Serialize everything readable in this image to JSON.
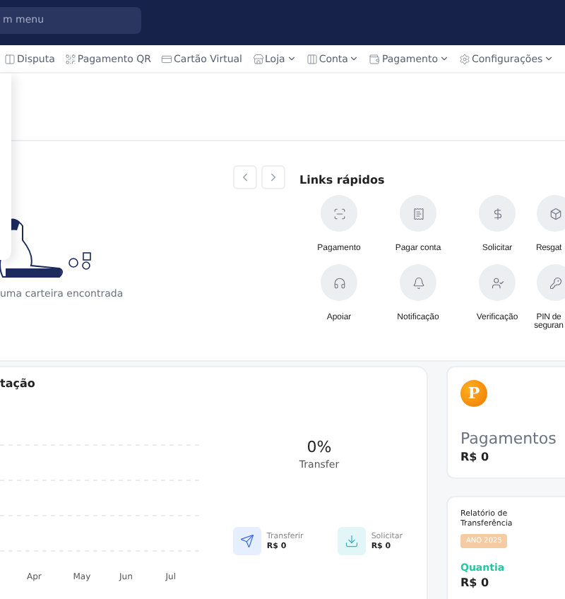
{
  "search": {
    "placeholder": "m menu"
  },
  "nav": [
    {
      "label": "Disputa",
      "kind": "dispute",
      "dropdown": false
    },
    {
      "label": "Pagamento QR",
      "kind": "qr",
      "dropdown": false
    },
    {
      "label": "Cartão Virtual",
      "kind": "card",
      "dropdown": false
    },
    {
      "label": "Loja",
      "kind": "store",
      "dropdown": true
    },
    {
      "label": "Conta",
      "kind": "account",
      "dropdown": true
    },
    {
      "label": "Pagamento",
      "kind": "wallet",
      "dropdown": true
    },
    {
      "label": "Configurações",
      "kind": "settings",
      "dropdown": true
    }
  ],
  "wallet": {
    "empty_text": "uma carteira encontrada"
  },
  "quick_links": {
    "title": "Links rápidos",
    "items": [
      {
        "label": "Pagamento",
        "kind": "payment"
      },
      {
        "label": "Pagar conta",
        "kind": "bill"
      },
      {
        "label": "Solicitar",
        "kind": "dollar"
      },
      {
        "label": "Resgat",
        "kind": "box"
      },
      {
        "label": "Apoiar",
        "kind": "headset"
      },
      {
        "label": "Notificação",
        "kind": "bell"
      },
      {
        "label": "Verificação",
        "kind": "user"
      },
      {
        "label": "PIN de seguran",
        "kind": "key"
      }
    ]
  },
  "chart_card": {
    "title": "tação",
    "x_labels": [
      "Apr",
      "May",
      "Jun",
      "Jul"
    ],
    "percent": "0%",
    "percent_label": "Transfer",
    "stats": [
      {
        "label": "Transferir",
        "value": "R$ 0",
        "kind": "transfer"
      },
      {
        "label": "Solicitar",
        "value": "R$ 0",
        "kind": "request"
      }
    ]
  },
  "payments_card": {
    "icon_letter": "P",
    "title": "Pagamentos",
    "value": "R$ 0"
  },
  "report_card": {
    "title": "Relatório de Transferência",
    "badge": "ANO 2025",
    "metric_label": "Quantia",
    "metric_value": "R$ 0"
  }
}
